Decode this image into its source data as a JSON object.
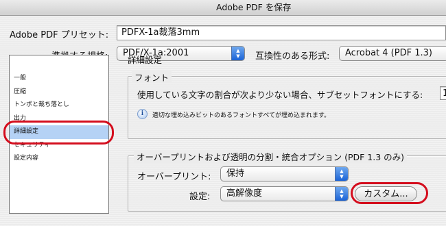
{
  "window": {
    "title": "Adobe PDF を保存"
  },
  "preset": {
    "label": "Adobe PDF プリセット:",
    "value": "PDFX-1a裁落3mm"
  },
  "standard": {
    "label": "準拠する規格:",
    "value": "PDF/X-1a:2001"
  },
  "compatibility": {
    "label": "互換性のある形式:",
    "value": "Acrobat 4 (PDF 1.3)"
  },
  "sidebar": {
    "items": [
      {
        "label": "一般"
      },
      {
        "label": "圧縮"
      },
      {
        "label": "トンボと裁ち落とし"
      },
      {
        "label": "出力"
      },
      {
        "label": "詳細設定"
      },
      {
        "label": "セキュリティ"
      },
      {
        "label": "設定内容"
      }
    ],
    "selected_index": 4
  },
  "main": {
    "section_title": "詳細設定",
    "font_group": {
      "title": "フォント",
      "subset_label": "使用している文字の割合が次より少ない場合、サブセットフォントにする:",
      "subset_value": "1",
      "info_text": "適切な埋め込みビットのあるフォントすべてが埋め込まれます。"
    },
    "overprint_group": {
      "title": "オーバープリントおよび透明の分割・統合オプション (PDF 1.3 のみ)",
      "overprint_label": "オーバープリント:",
      "overprint_value": "保持",
      "settings_label": "設定:",
      "settings_value": "高解像度",
      "custom_button": "カスタム..."
    }
  },
  "colors": {
    "highlight": "#d40d1d",
    "selection": "#b5d2f5",
    "popup_accent": "#2f78e0"
  },
  "icons": {
    "info": "info-icon",
    "popup_arrows": "updown-arrows-icon"
  }
}
